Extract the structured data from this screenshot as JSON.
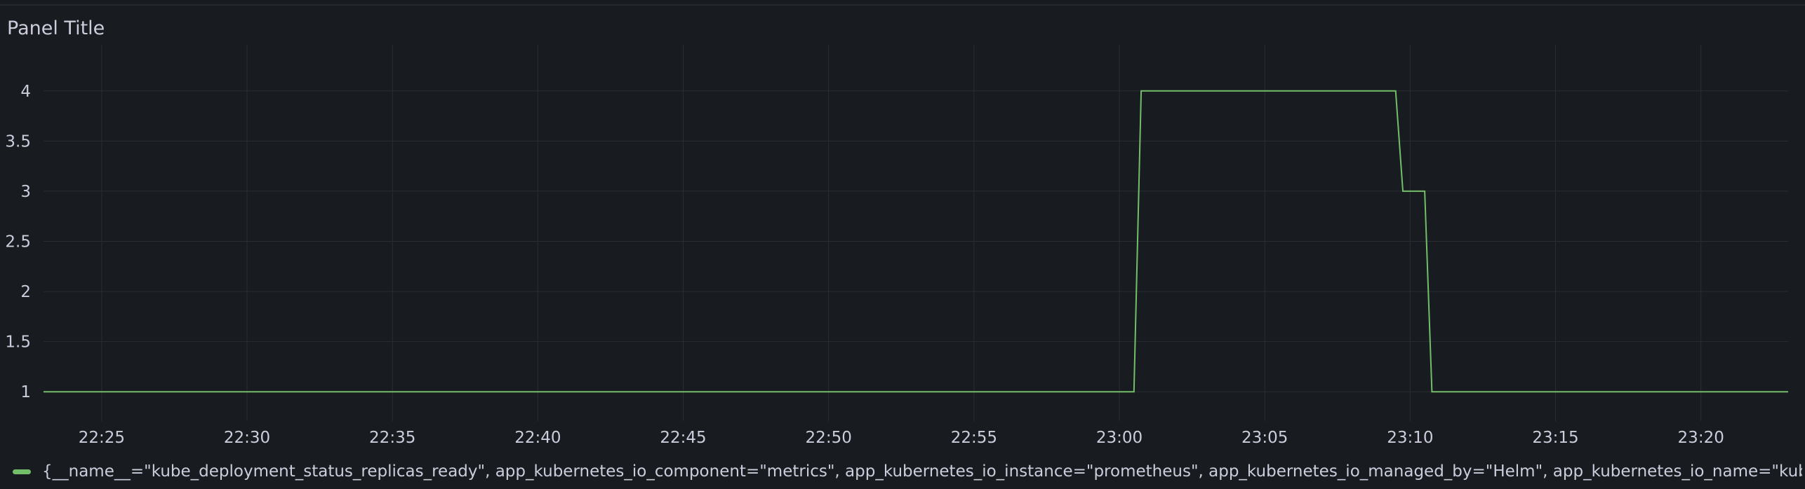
{
  "panel": {
    "title": "Panel Title"
  },
  "colors": {
    "background": "#181b1f",
    "grid": "#2a2d33",
    "axis_text": "#ccccdc",
    "series": "#73bf69"
  },
  "chart_data": {
    "type": "line",
    "title": "",
    "xlabel": "",
    "ylabel": "",
    "x_ticks": [
      "22:25",
      "22:30",
      "22:35",
      "22:40",
      "22:45",
      "22:50",
      "22:55",
      "23:00",
      "23:05",
      "23:10",
      "23:15",
      "23:20"
    ],
    "y_ticks": [
      "1",
      "1.5",
      "2",
      "2.5",
      "3",
      "3.5",
      "4"
    ],
    "xlim": [
      "22:23",
      "23:23"
    ],
    "ylim": [
      0.75,
      4.25
    ],
    "grid": true,
    "legend_position": "bottom-left",
    "series": [
      {
        "name": "{__name__=\"kube_deployment_status_replicas_ready\", app_kubernetes_io_component=\"metrics\", app_kubernetes_io_instance=\"prometheus\", app_kubernetes_io_managed_by=\"Helm\", app_kubernetes_io_name=\"kube-",
        "points": [
          [
            "22:23",
            1
          ],
          [
            "23:00:30",
            1
          ],
          [
            "23:00:45",
            4
          ],
          [
            "23:09:30",
            4
          ],
          [
            "23:09:45",
            3
          ],
          [
            "23:10:30",
            3
          ],
          [
            "23:10:45",
            1
          ],
          [
            "23:23",
            1
          ]
        ]
      }
    ]
  }
}
